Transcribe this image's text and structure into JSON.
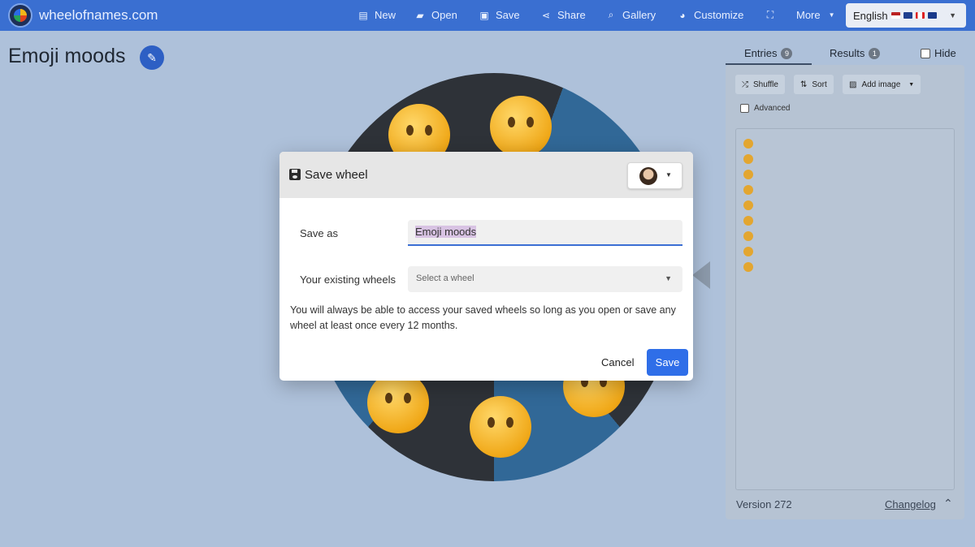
{
  "header": {
    "brand": "wheelofnames.com",
    "nav": [
      {
        "label": "New",
        "icon": "file-icon"
      },
      {
        "label": "Open",
        "icon": "folder-open-icon"
      },
      {
        "label": "Save",
        "icon": "floppy-icon"
      },
      {
        "label": "Share",
        "icon": "share-icon"
      },
      {
        "label": "Gallery",
        "icon": "search-icon"
      },
      {
        "label": "Customize",
        "icon": "palette-icon"
      },
      {
        "label": "",
        "icon": "fullscreen-icon"
      },
      {
        "label": "More",
        "icon": "chevron-down-icon"
      }
    ],
    "language": "English"
  },
  "page": {
    "title": "Emoji moods"
  },
  "panel": {
    "tabs": [
      {
        "label": "Entries",
        "count": "9"
      },
      {
        "label": "Results",
        "count": "1"
      }
    ],
    "hide_label": "Hide",
    "shuffle_label": "Shuffle",
    "sort_label": "Sort",
    "add_image_label": "Add image",
    "advanced_label": "Advanced",
    "entry_count": 9,
    "version": "Version 272",
    "changelog": "Changelog"
  },
  "dialog": {
    "title": "Save wheel",
    "save_as_label": "Save as",
    "save_as_value": "Emoji moods",
    "existing_label": "Your existing wheels",
    "select_placeholder": "Select a wheel",
    "note": "You will always be able to access your saved wheels so long as you open or save any wheel at least once every 12 months.",
    "cancel_label": "Cancel",
    "save_label": "Save"
  },
  "colors": {
    "topbar": "#3a6fd1",
    "primary_button": "#2f6ee8",
    "overlay": "#aec1da"
  }
}
